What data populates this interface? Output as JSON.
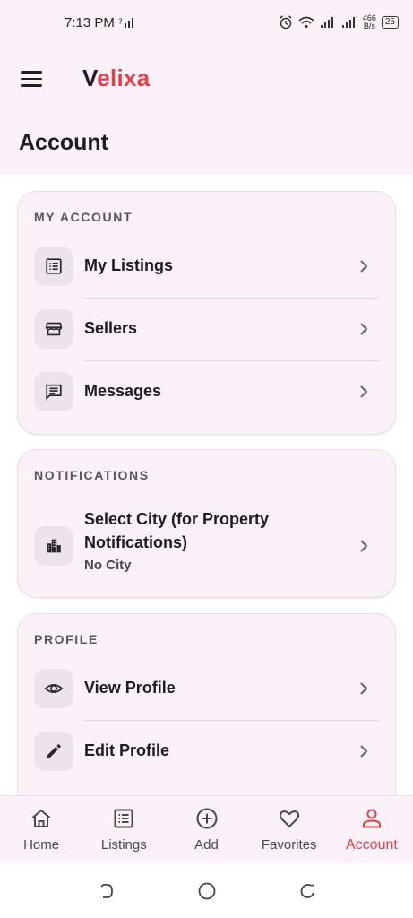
{
  "status_bar": {
    "time": "7:13 PM",
    "net_speed_value": "466",
    "net_speed_unit": "B/s",
    "battery": "25"
  },
  "app": {
    "brand_first": "V",
    "brand_rest": "elixa",
    "brand_color": "#e0424c",
    "page_title": "Account"
  },
  "my_account": {
    "title": "MY ACCOUNT",
    "items": [
      {
        "label": "My Listings",
        "icon": "list-icon"
      },
      {
        "label": "Sellers",
        "icon": "storefront-icon"
      },
      {
        "label": "Messages",
        "icon": "message-icon"
      }
    ]
  },
  "notifications": {
    "title": "NOTIFICATIONS",
    "select_city": {
      "label": "Select City (for Property Notifications)",
      "value": "No City",
      "icon": "city-icon"
    }
  },
  "profile": {
    "title": "PROFILE",
    "items": [
      {
        "label": "View Profile",
        "icon": "eye-icon"
      },
      {
        "label": "Edit Profile",
        "icon": "pencil-icon"
      }
    ]
  },
  "bottom_nav": {
    "items": [
      {
        "label": "Home",
        "icon": "home-icon"
      },
      {
        "label": "Listings",
        "icon": "listings-icon"
      },
      {
        "label": "Add",
        "icon": "add-circle-icon"
      },
      {
        "label": "Favorites",
        "icon": "heart-icon"
      },
      {
        "label": "Account",
        "icon": "person-icon",
        "active": true
      }
    ],
    "active_color": "#e0424c"
  }
}
